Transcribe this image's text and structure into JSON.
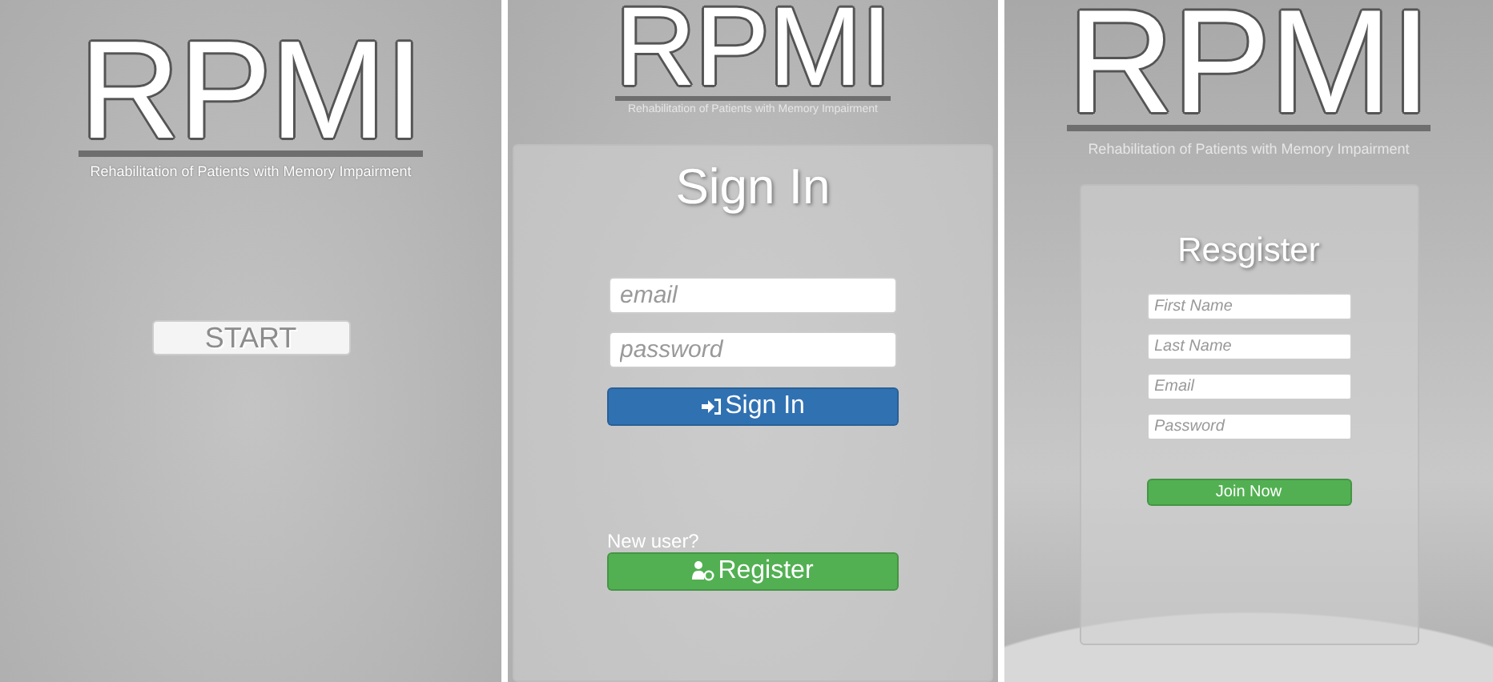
{
  "start_screen": {
    "logo": {
      "title": "RPMI",
      "subtitle": "Rehabilitation of Patients with Memory Impairment"
    },
    "start_button": "START"
  },
  "sign_in_screen": {
    "logo": {
      "title": "RPMI",
      "subtitle": "Rehabilitation of Patients with Memory Impairment"
    },
    "heading": "Sign In",
    "fields": [
      {
        "placeholder": "email"
      },
      {
        "placeholder": "password"
      }
    ],
    "sign_in_button": "Sign In",
    "new_user_label": "New user?",
    "register_button": "Register"
  },
  "register_screen": {
    "logo": {
      "title": "RPMI",
      "subtitle": "Rehabilitation of Patients with Memory Impairment"
    },
    "heading": "Resgister",
    "fields": [
      {
        "placeholder": "First Name"
      },
      {
        "placeholder": "Last Name"
      },
      {
        "placeholder": "Email"
      },
      {
        "placeholder": "Password"
      }
    ],
    "join_button": "Join Now"
  }
}
